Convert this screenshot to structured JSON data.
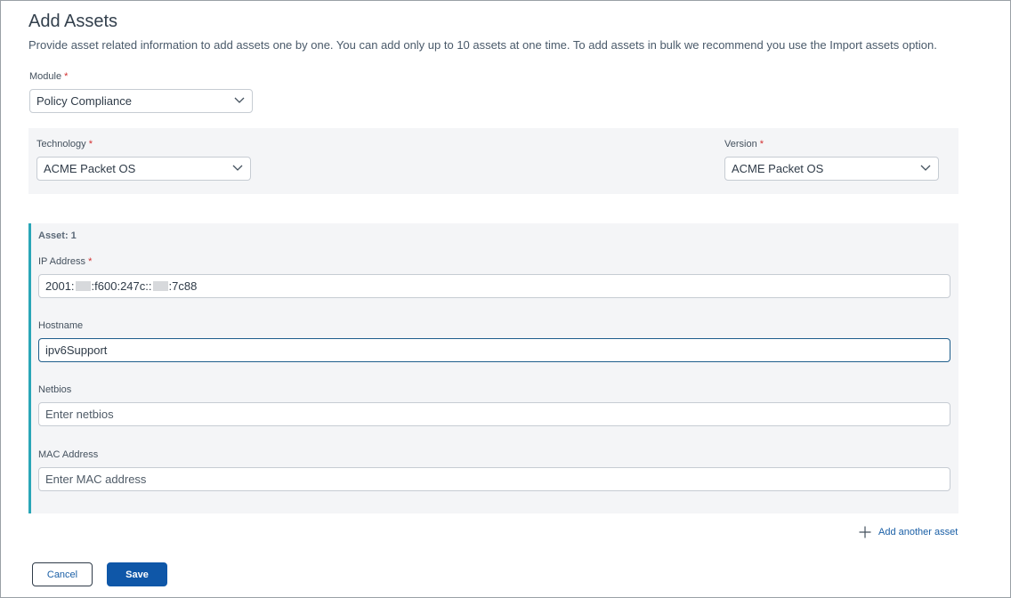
{
  "page": {
    "title": "Add Assets",
    "description": "Provide asset related information to add assets one by one. You can add only up to 10 assets at one time. To add assets in bulk we recommend you use the Import assets option."
  },
  "module": {
    "label": "Module",
    "required_mark": "*",
    "value": "Policy Compliance"
  },
  "technology": {
    "label": "Technology",
    "required_mark": "*",
    "value": "ACME Packet OS"
  },
  "version": {
    "label": "Version",
    "required_mark": "*",
    "value": "ACME Packet OS"
  },
  "asset": {
    "title": "Asset: 1",
    "ip": {
      "label": "IP Address",
      "required_mark": "*",
      "parts": [
        "2001:",
        ":f600:247c::",
        ":7c88"
      ]
    },
    "hostname": {
      "label": "Hostname",
      "value": "ipv6Support"
    },
    "netbios": {
      "label": "Netbios",
      "placeholder": "Enter netbios"
    },
    "mac": {
      "label": "MAC Address",
      "placeholder": "Enter MAC address"
    }
  },
  "actions": {
    "add_another": "Add another asset",
    "cancel": "Cancel",
    "save": "Save"
  },
  "colors": {
    "accent": "#0f57a8",
    "panel_bg": "#f4f5f7",
    "asset_border": "#2aa6b7",
    "required": "#d32f2f"
  }
}
